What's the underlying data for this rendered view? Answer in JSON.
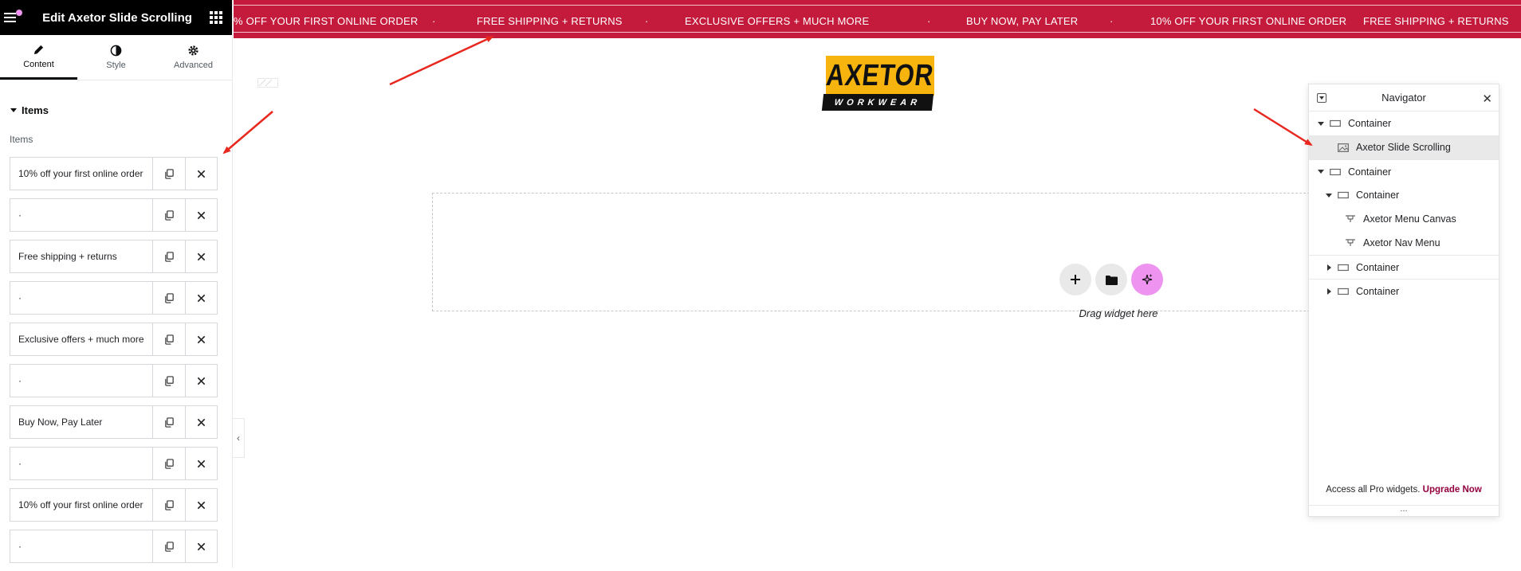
{
  "panel": {
    "title": "Edit Axetor Slide Scrolling",
    "tabs": [
      {
        "label": "Content",
        "icon": "pencil-icon"
      },
      {
        "label": "Style",
        "icon": "half-circle-icon"
      },
      {
        "label": "Advanced",
        "icon": "gear-icon"
      }
    ],
    "section_title": "Items",
    "items_label": "Items",
    "items": [
      "10% off your first online order",
      "·",
      "Free shipping + returns",
      "·",
      "Exclusive offers + much more",
      "·",
      "Buy Now, Pay Later",
      "·",
      "10% off your first online order",
      "·"
    ],
    "collapse_glyph": "‹"
  },
  "marquee": {
    "items": [
      "% OFF YOUR FIRST ONLINE ORDER",
      "·",
      "FREE SHIPPING + RETURNS",
      "·",
      "EXCLUSIVE OFFERS + MUCH MORE",
      "·",
      "BUY NOW, PAY LATER",
      "·",
      "10% OFF YOUR FIRST ONLINE ORDER",
      "·",
      "FREE SHIPPING + RETURNS"
    ],
    "background": "#c41a3b"
  },
  "logo": {
    "top": "AXETOR",
    "bottom": "WORKWEAR"
  },
  "dropzone": {
    "text": "Drag widget here"
  },
  "navigator": {
    "title": "Navigator",
    "items": [
      {
        "label": "Container",
        "caret": "down",
        "icon": "container-icon"
      },
      {
        "label": "Axetor Slide Scrolling",
        "caret": "",
        "icon": "image-icon"
      },
      {
        "label": "Container",
        "caret": "down",
        "icon": "container-icon"
      },
      {
        "label": "Container",
        "caret": "down",
        "icon": "container-icon"
      },
      {
        "label": "Axetor Menu Canvas",
        "caret": "",
        "icon": "widget-icon"
      },
      {
        "label": "Axetor Nav Menu",
        "caret": "",
        "icon": "widget-icon"
      },
      {
        "label": "Container",
        "caret": "right",
        "icon": "container-icon"
      },
      {
        "label": "Container",
        "caret": "right",
        "icon": "container-icon"
      }
    ],
    "footer_text": "Access all Pro widgets.",
    "footer_link": "Upgrade Now",
    "dots": "..."
  },
  "colors": {
    "accent": "#c41a3b",
    "ai": "#ee94f0",
    "annotation": "#e8271e",
    "upgrade": "#93003f"
  }
}
